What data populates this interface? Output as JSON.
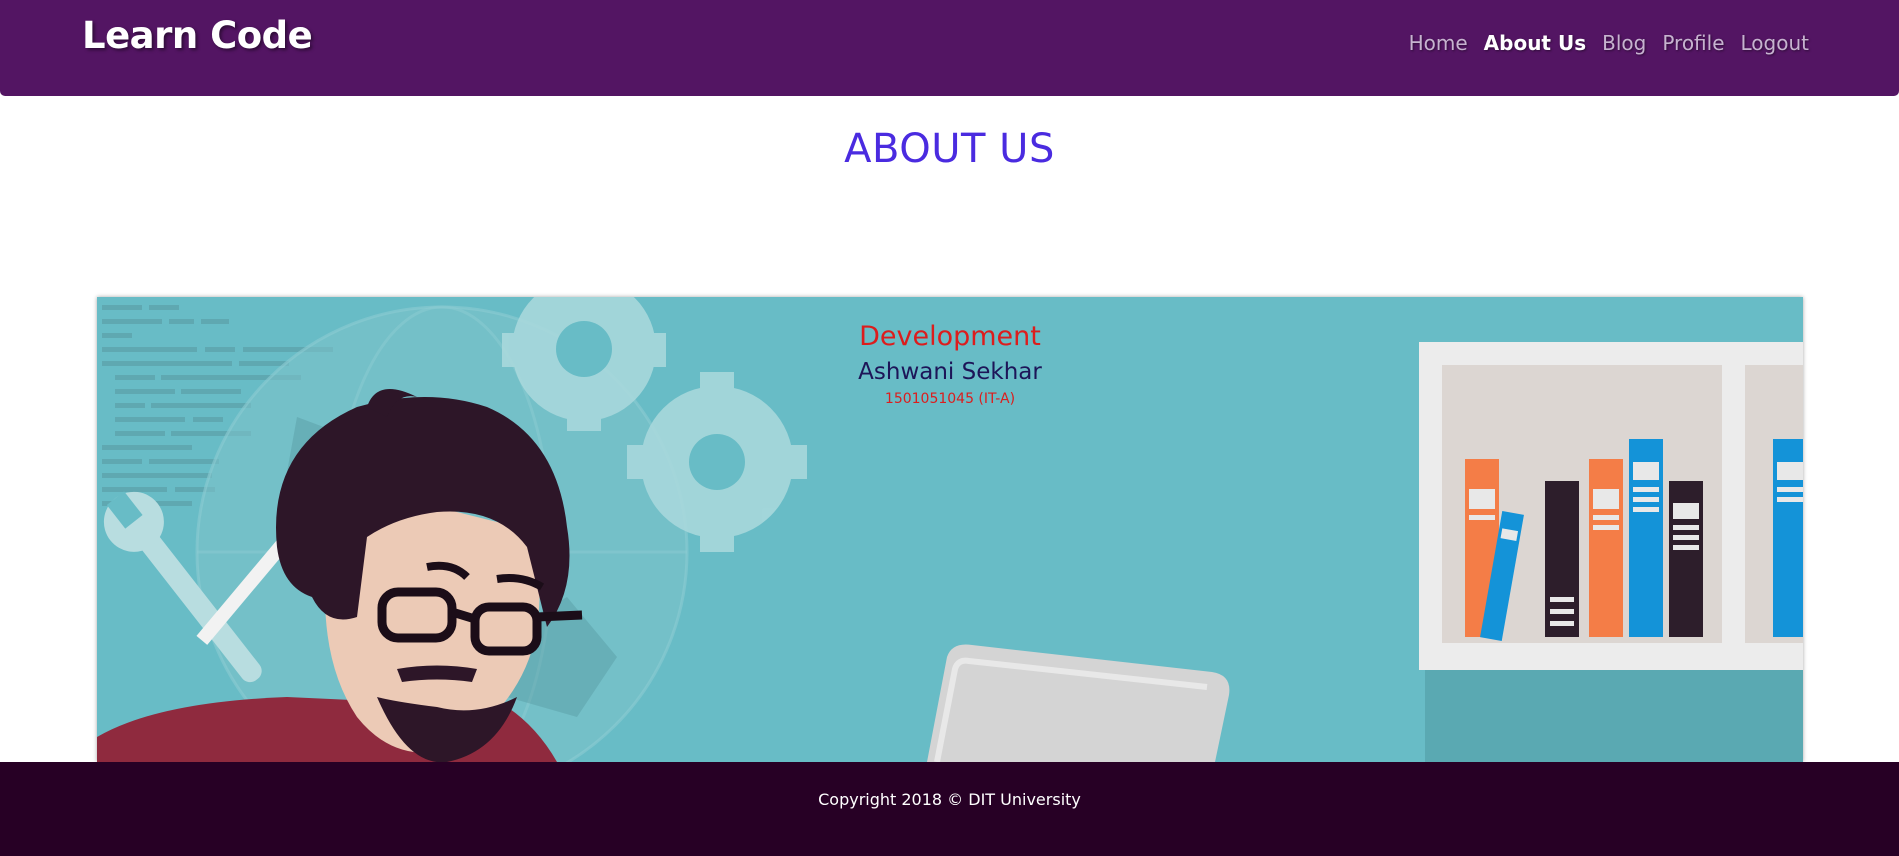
{
  "navbar": {
    "brand": "Learn Code",
    "links": [
      {
        "label": "Home"
      },
      {
        "label": "About Us",
        "active": true
      },
      {
        "label": "Blog"
      },
      {
        "label": "Profile"
      },
      {
        "label": "Logout"
      }
    ]
  },
  "main": {
    "title": "ABOUT US",
    "team_card": {
      "department": "Development",
      "member_name": "Ashwani Sekhar",
      "roll_number": "1501051045 (IT-A)"
    }
  },
  "footer": {
    "copyright": "Copyright 2018 © DIT University"
  },
  "colors": {
    "navbar_bg": "#531563",
    "title": "#4a2be0",
    "card_bg": "#68bcc6",
    "department": "#dc1d1d",
    "member_name": "#1d1558",
    "footer_bg": "#270025"
  }
}
